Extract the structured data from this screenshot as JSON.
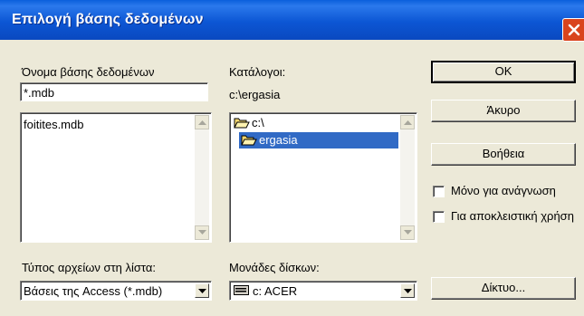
{
  "window": {
    "title": "Επιλογή βάσης δεδομένων"
  },
  "database": {
    "label": "Όνομα βάσης δεδομένων",
    "filename_value": "*.mdb",
    "files": [
      "foitites.mdb"
    ]
  },
  "directories": {
    "label": "Κατάλογοι:",
    "current_path": "c:\\ergasia",
    "tree": [
      {
        "label": "c:\\",
        "state": "open"
      },
      {
        "label": "ergasia",
        "state": "open-selected"
      }
    ]
  },
  "file_types": {
    "label": "Τύπος αρχείων στη λίστα:",
    "selected": "Βάσεις της Access (*.mdb)"
  },
  "drives": {
    "label": "Μονάδες δίσκων:",
    "selected": "c: ACER",
    "icon": "drive-icon"
  },
  "buttons": {
    "ok": "OK",
    "cancel": "Άκυρο",
    "help": "Βοήθεια",
    "network": "Δίκτυο..."
  },
  "options": {
    "read_only": "Μόνο για ανάγνωση",
    "exclusive": "Για αποκλειστική χρήση"
  },
  "colors": {
    "titlebar": "#0a5fdc",
    "selection": "#316ac5",
    "close": "#d9441d",
    "face": "#ece9d8"
  }
}
